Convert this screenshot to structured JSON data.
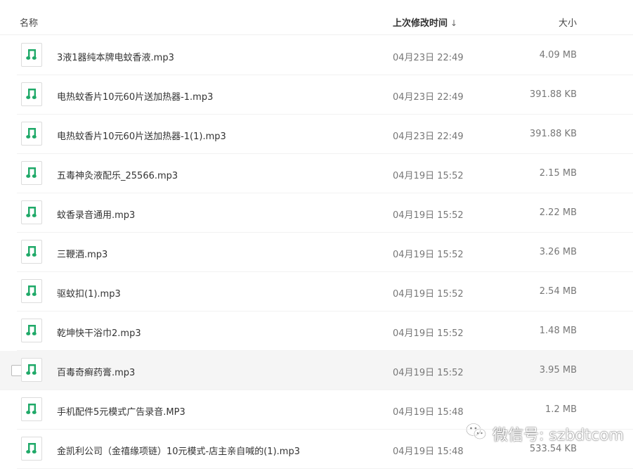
{
  "header": {
    "name_label": "名称",
    "time_label": "上次修改时间",
    "size_label": "大小"
  },
  "files": [
    {
      "name": "3液1器纯本牌电蚊香液.mp3",
      "time": "04月23日 22:49",
      "size": "4.09 MB"
    },
    {
      "name": "电热蚊香片10元60片送加热器-1.mp3",
      "time": "04月23日 22:49",
      "size": "391.88 KB"
    },
    {
      "name": "电热蚊香片10元60片送加热器-1(1).mp3",
      "time": "04月23日 22:49",
      "size": "391.88 KB"
    },
    {
      "name": "五毒神灸液配乐_25566.mp3",
      "time": "04月19日 15:52",
      "size": "2.15 MB"
    },
    {
      "name": "蚊香录音通用.mp3",
      "time": "04月19日 15:52",
      "size": "2.22 MB"
    },
    {
      "name": "三鞭酒.mp3",
      "time": "04月19日 15:52",
      "size": "3.26 MB"
    },
    {
      "name": "驱蚊扣(1).mp3",
      "time": "04月19日 15:52",
      "size": "2.54 MB"
    },
    {
      "name": "乾坤快干浴巾2.mp3",
      "time": "04月19日 15:52",
      "size": "1.48 MB"
    },
    {
      "name": "百毒奇癣药膏.mp3",
      "time": "04月19日 15:52",
      "size": "3.95 MB"
    },
    {
      "name": "手机配件5元模式广告录音.MP3",
      "time": "04月19日 15:48",
      "size": "1.2 MB"
    },
    {
      "name": "金凯利公司（金禧缘项链）10元模式-店主亲自喊的(1).mp3",
      "time": "04月19日 15:48",
      "size": "533.54 KB"
    }
  ],
  "hover_row_index": 8,
  "watermark": {
    "text": "微信号: szbdtcom",
    "icon": "wechat-icon"
  },
  "colors": {
    "music_icon": "#1fa968",
    "hover_bg": "#f5f5f5"
  }
}
